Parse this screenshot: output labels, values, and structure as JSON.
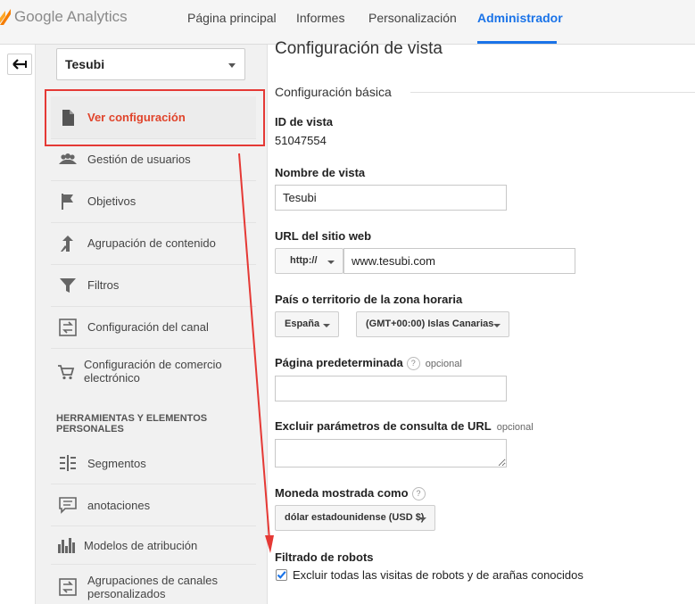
{
  "brand": {
    "logo_text": "Google Analytics"
  },
  "nav": {
    "tabs": [
      {
        "label": "Página principal"
      },
      {
        "label": "Informes"
      },
      {
        "label": "Personalización"
      },
      {
        "label": "Administrador"
      }
    ],
    "active_tab": "Administrador"
  },
  "sidebar": {
    "view_selector": "Tesubi",
    "items": [
      {
        "label": "Ver configuración",
        "icon": "document-icon"
      },
      {
        "label": "Gestión de usuarios",
        "icon": "users-icon"
      },
      {
        "label": "Objetivos",
        "icon": "flag-icon"
      },
      {
        "label": "Agrupación de contenido",
        "icon": "merge-icon"
      },
      {
        "label": "Filtros",
        "icon": "filter-icon"
      },
      {
        "label": "Configuración del canal",
        "icon": "channel-icon"
      },
      {
        "label": "Configuración de comercio electrónico",
        "icon": "cart-icon"
      }
    ],
    "tools_heading": "HERRAMIENTAS Y ELEMENTOS PERSONALES",
    "tools_items": [
      {
        "label": "Segmentos",
        "icon": "segments-icon"
      },
      {
        "label": "anotaciones",
        "icon": "annotation-icon"
      },
      {
        "label": "Modelos de atribución",
        "icon": "bar-chart-icon"
      },
      {
        "label": "Agrupaciones de canales personalizados",
        "icon": "channel-icon"
      }
    ]
  },
  "main": {
    "page_title": "Configuración de vista",
    "section_title": "Configuración básica",
    "view_id_label": "ID de vista",
    "view_id": "51047554",
    "view_name_label": "Nombre de vista",
    "view_name": "Tesubi",
    "url_label": "URL del sitio web",
    "protocol": "http://",
    "url": "www.tesubi.com",
    "timezone_label": "País o territorio de la zona horaria",
    "country": "España",
    "timezone": "(GMT+00:00) Islas Canarias",
    "default_page_label": "Página predeterminada",
    "optional": "opcional",
    "help_glyph": "?",
    "default_page": "",
    "exclude_params_label": "Excluir parámetros de consulta de URL",
    "currency_label": "Moneda mostrada como",
    "currency": "dólar estadounidense (USD $)",
    "bot_filter_label": "Filtrado de robots",
    "bot_filter_text": "Excluir todas las visitas de robots y de arañas conocidos",
    "bot_filter_checked": true
  },
  "colors": {
    "accent": "#1a73e8",
    "highlight": "#e53935",
    "active_item_text": "#e0442b"
  }
}
